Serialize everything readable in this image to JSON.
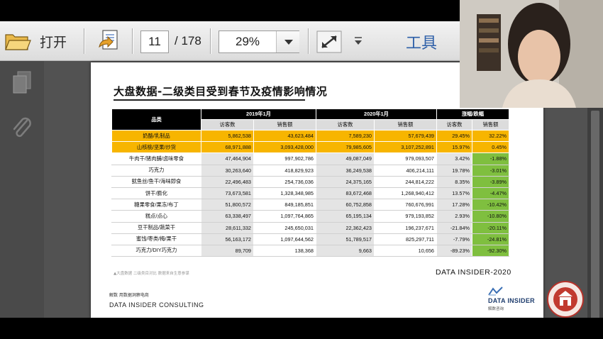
{
  "toolbar": {
    "open_label": "打开",
    "page_current": "11",
    "page_total": "/ 178",
    "zoom": "29%",
    "tools_label": "工具",
    "icons": [
      "folder-open-icon",
      "export-icon",
      "chevron-down-icon",
      "fullscreen-icon",
      "more-icon"
    ]
  },
  "sidebar": {
    "icons": [
      "pages-icon",
      "paperclip-icon"
    ]
  },
  "slide": {
    "title": "大盘数据-二级类目受到春节及疫情影响情况",
    "table": {
      "col_category": "品类",
      "group_2019": "2019年1月",
      "group_2020": "2020年1月",
      "group_change": "涨幅/跌幅",
      "sub_visitors": "访客数",
      "sub_sales": "销售额",
      "rows": [
        {
          "cat": "奶酪/乳制品",
          "v19": "5,862,538",
          "s19": "43,623,484",
          "v20": "7,589,230",
          "s20": "57,679,439",
          "dv": "29.45%",
          "ds": "32.22%",
          "highlight": true
        },
        {
          "cat": "山核桃/坚果/炒货",
          "v19": "68,971,888",
          "s19": "3,093,428,000",
          "v20": "79,985,605",
          "s20": "3,107,252,891",
          "dv": "15.97%",
          "ds": "0.45%",
          "highlight": true
        },
        {
          "cat": "牛肉干/猪肉脯/卤味零食",
          "v19": "47,464,904",
          "s19": "997,902,786",
          "v20": "49,087,049",
          "s20": "979,093,507",
          "dv": "3.42%",
          "ds": "-1.88%",
          "highlight": false
        },
        {
          "cat": "巧克力",
          "v19": "30,263,640",
          "s19": "418,829,923",
          "v20": "36,249,538",
          "s20": "406,214,111",
          "dv": "19.78%",
          "ds": "-3.01%",
          "highlight": false
        },
        {
          "cat": "鱿鱼丝/鱼干/海味即食",
          "v19": "22,496,483",
          "s19": "254,736,036",
          "v20": "24,375,165",
          "s20": "244,814,222",
          "dv": "8.35%",
          "ds": "-3.89%",
          "highlight": false
        },
        {
          "cat": "饼干/膨化",
          "v19": "73,673,581",
          "s19": "1,328,348,985",
          "v20": "83,672,468",
          "s20": "1,268,940,412",
          "dv": "13.57%",
          "ds": "-4.47%",
          "highlight": false
        },
        {
          "cat": "糖果零食/果冻/布丁",
          "v19": "51,800,572",
          "s19": "849,185,851",
          "v20": "60,752,858",
          "s20": "760,676,991",
          "dv": "17.28%",
          "ds": "-10.42%",
          "highlight": false
        },
        {
          "cat": "糕点/点心",
          "v19": "63,338,497",
          "s19": "1,097,764,865",
          "v20": "65,195,134",
          "s20": "979,193,852",
          "dv": "2.93%",
          "ds": "-10.80%",
          "highlight": false
        },
        {
          "cat": "豆干制品/蔬菜干",
          "v19": "28,611,332",
          "s19": "245,650,031",
          "v20": "22,362,423",
          "s20": "196,237,671",
          "dv": "-21.84%",
          "ds": "-20.11%",
          "highlight": false
        },
        {
          "cat": "蜜饯/枣类/梅/果干",
          "v19": "56,163,172",
          "s19": "1,097,644,562",
          "v20": "51,789,517",
          "s20": "825,297,711",
          "dv": "-7.79%",
          "ds": "-24.81%",
          "highlight": false
        },
        {
          "cat": "巧克力/DIY巧克力",
          "v19": "89,709",
          "s19": "138,368",
          "v20": "9,663",
          "s20": "10,656",
          "dv": "-89.23%",
          "ds": "-92.30%",
          "highlight": false
        }
      ]
    },
    "footnote": "▲大盘数据 二级类目对比 数据来自生意参谋",
    "brand_label": "DATA INSIDER-2020",
    "footer_small": "解数 用数据洞察电商",
    "footer_company": "DATA INSIDER CONSULTING",
    "logo_text": "DATA INSIDER",
    "logo_cn": "解数咨询"
  },
  "colors": {
    "highlight_row": "#f7b500",
    "negative_sales": "#7fbf3f",
    "header_bg": "#000000",
    "tools_text": "#2d5fa8"
  }
}
